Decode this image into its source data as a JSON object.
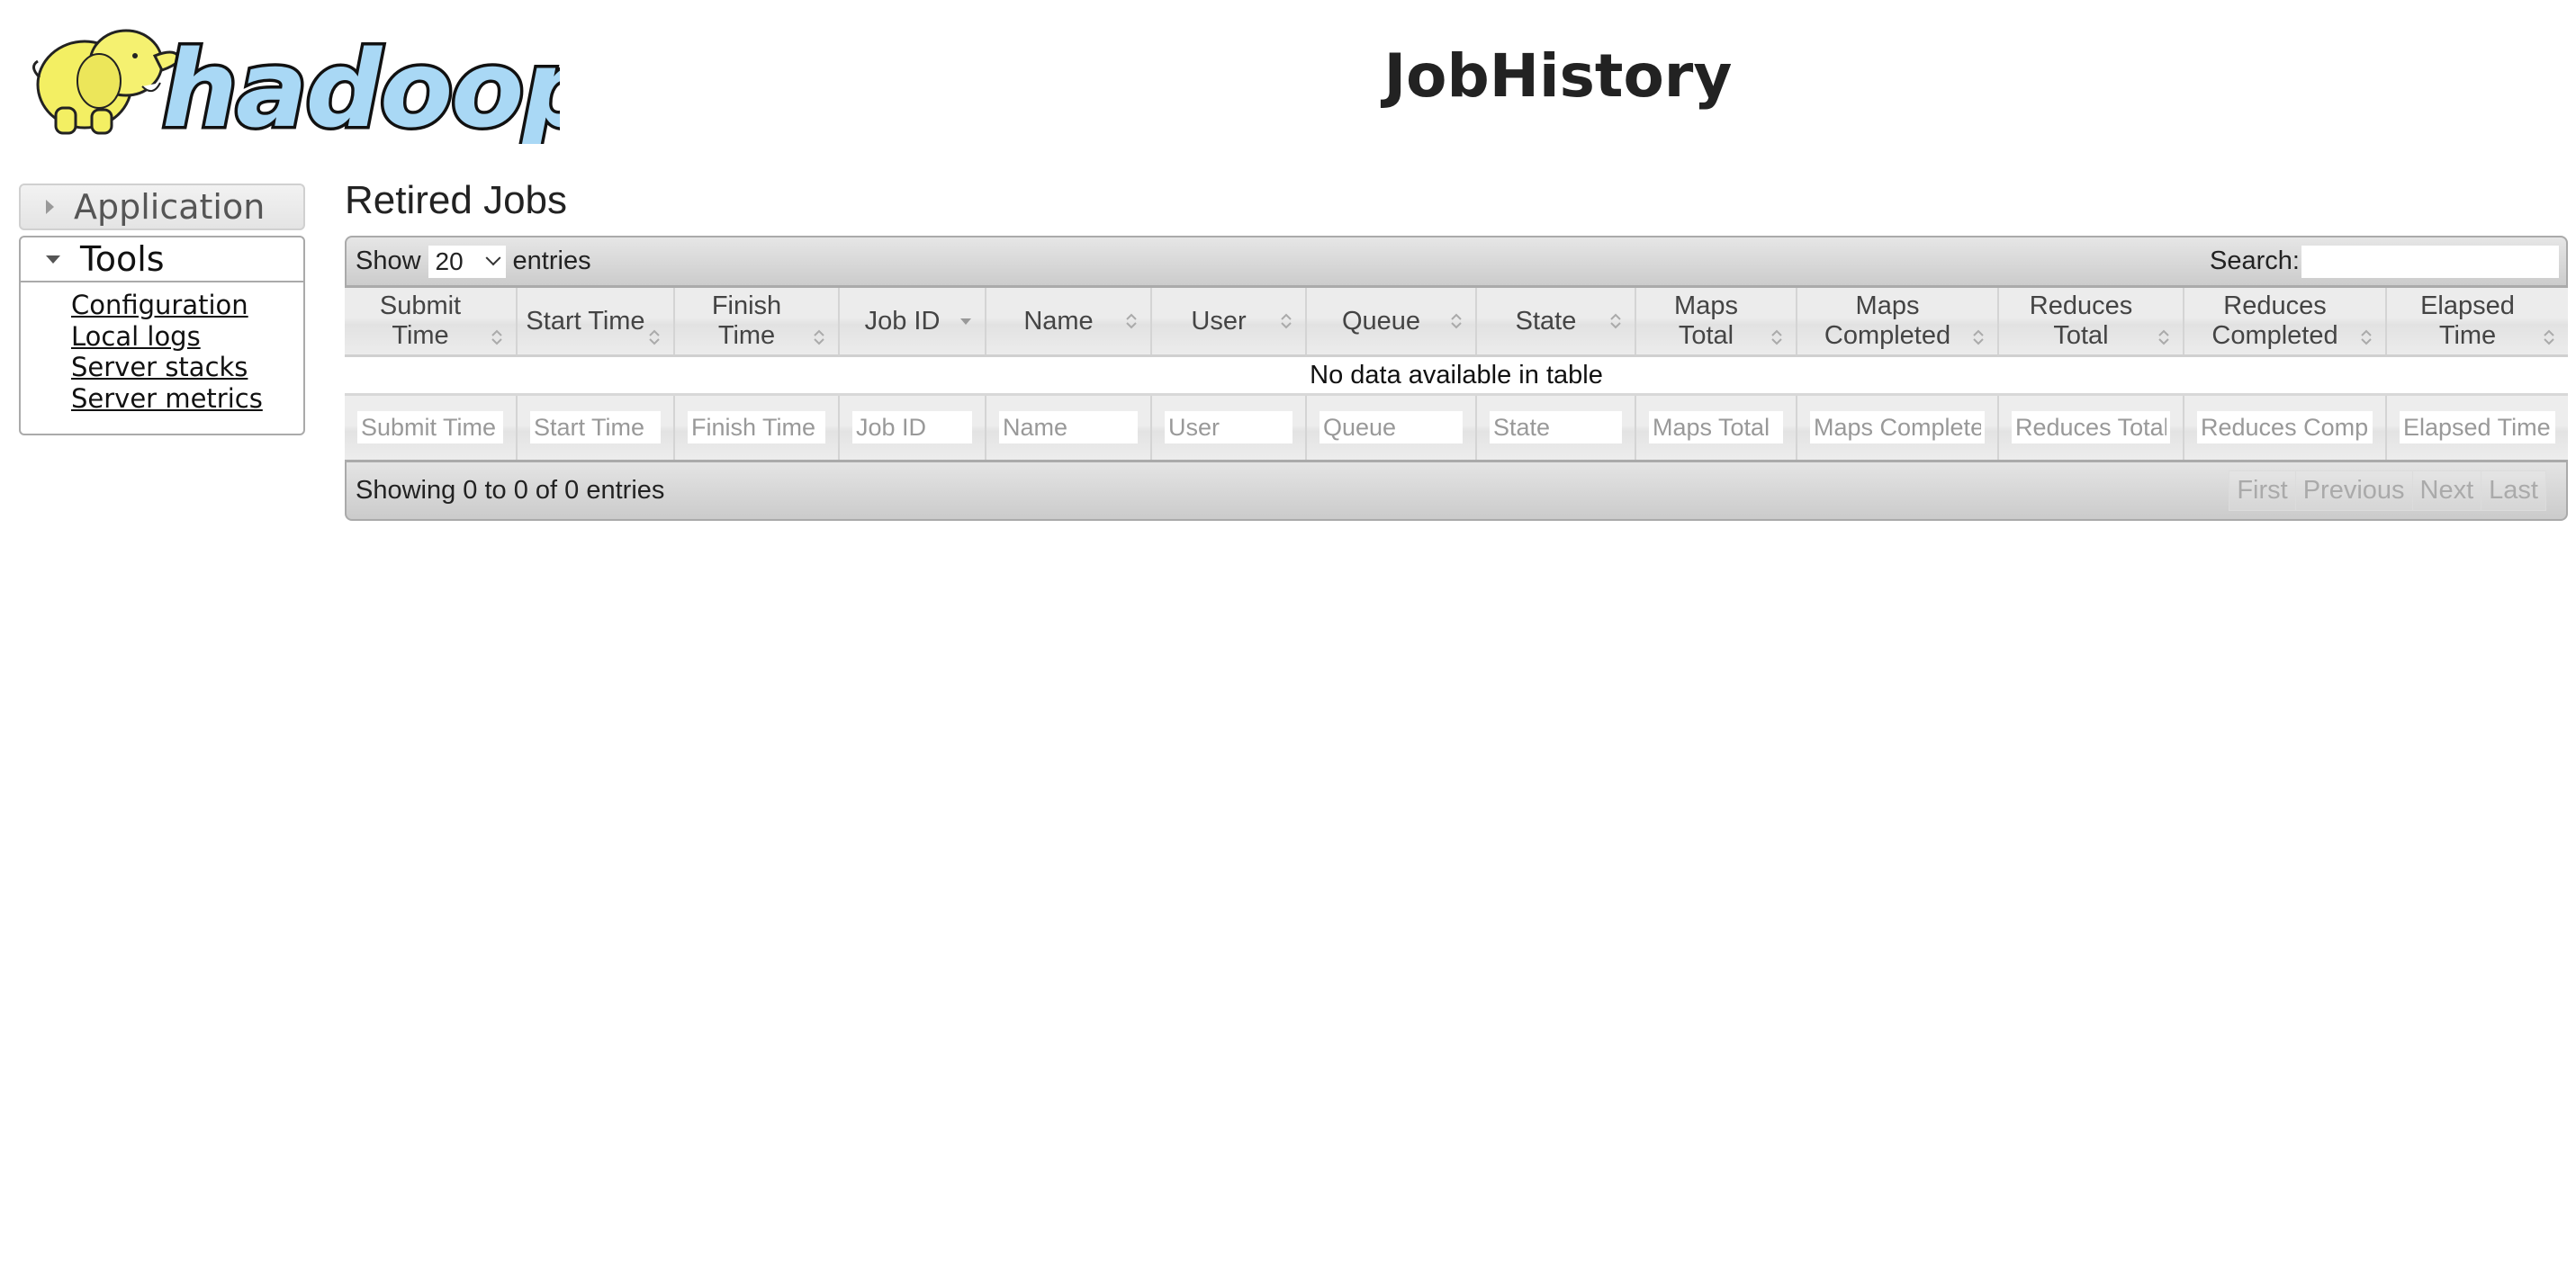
{
  "header": {
    "logo_text": "hadoop",
    "title": "JobHistory"
  },
  "sidebar": {
    "sections": [
      {
        "label": "Application",
        "expanded": false
      },
      {
        "label": "Tools",
        "expanded": true
      }
    ],
    "tools_links": [
      "Configuration",
      "Local logs",
      "Server stacks",
      "Server metrics"
    ]
  },
  "main": {
    "title": "Retired Jobs",
    "length_menu": {
      "prefix": "Show",
      "value": "20",
      "suffix": "entries"
    },
    "search": {
      "label": "Search:",
      "value": ""
    },
    "columns": [
      {
        "label": "Submit Time",
        "sort": "both"
      },
      {
        "label": "Start Time",
        "sort": "both"
      },
      {
        "label": "Finish Time",
        "sort": "both"
      },
      {
        "label": "Job ID",
        "sort": "desc"
      },
      {
        "label": "Name",
        "sort": "both"
      },
      {
        "label": "User",
        "sort": "both"
      },
      {
        "label": "Queue",
        "sort": "both"
      },
      {
        "label": "State",
        "sort": "both"
      },
      {
        "label": "Maps Total",
        "sort": "both"
      },
      {
        "label": "Maps Completed",
        "sort": "both"
      },
      {
        "label": "Reduces Total",
        "sort": "both"
      },
      {
        "label": "Reduces Completed",
        "sort": "both"
      },
      {
        "label": "Elapsed Time",
        "sort": "both"
      }
    ],
    "empty_message": "No data available in table",
    "filter_placeholders": [
      "Submit Time",
      "Start Time",
      "Finish Time",
      "Job ID",
      "Name",
      "User",
      "Queue",
      "State",
      "Maps Total",
      "Maps Completed",
      "Reduces Total",
      "Reduces Completed",
      "Elapsed Time"
    ],
    "info": "Showing 0 to 0 of 0 entries",
    "pagination": [
      "First",
      "Previous",
      "Next",
      "Last"
    ]
  },
  "colors": {
    "logo_elephant": "#f2ee5a",
    "logo_text_fill": "#a9d8f5",
    "text": "#222222",
    "disabled_pager": "#aaaaaa"
  }
}
